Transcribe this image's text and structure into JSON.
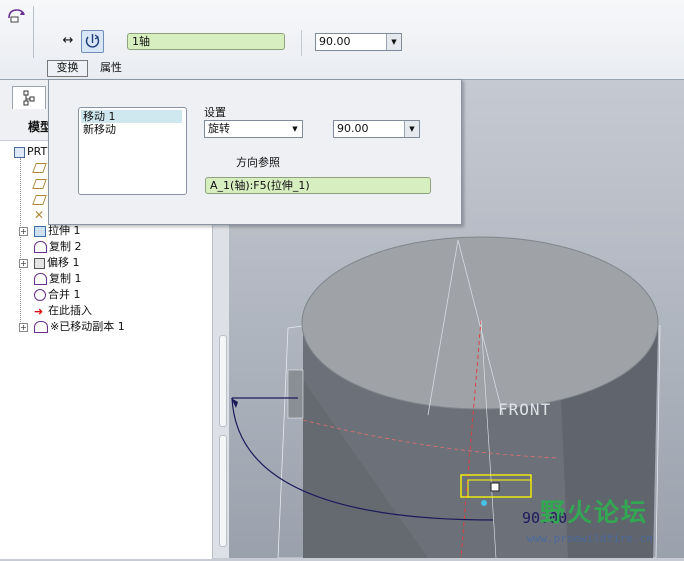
{
  "dashboard": {
    "axis_value": "1轴",
    "angle_value": "90.00",
    "tabs": [
      "变换",
      "属性"
    ]
  },
  "panel": {
    "moves": [
      "移动 1",
      "新移动"
    ],
    "settings_label": "设置",
    "settings_value": "旋转",
    "angle_value": "90.00",
    "direction_ref_label": "方向参照",
    "direction_ref_value": "A_1(轴):F5(拉伸_1)"
  },
  "navigator": {
    "title": "模型",
    "root_label": "PRT",
    "items": [
      {
        "label": "拉伸 1",
        "icon": "extrude-icon",
        "expandable": true
      },
      {
        "label": "复制 2",
        "icon": "copy-icon",
        "expandable": false
      },
      {
        "label": "偏移 1",
        "icon": "offset-icon",
        "expandable": true
      },
      {
        "label": "复制 1",
        "icon": "copy-icon",
        "expandable": false
      },
      {
        "label": "合并 1",
        "icon": "merge-icon",
        "expandable": false
      },
      {
        "label": "在此插入",
        "icon": "insert-here-arrow-icon",
        "expandable": false
      },
      {
        "label": "※已移动副本 1",
        "icon": "moved-copy-icon",
        "expandable": true
      }
    ]
  },
  "graphics": {
    "plane_label": "FRONT",
    "dimension_label": "90.00"
  },
  "watermark": {
    "title": "野火论坛",
    "url": "www.proewildfire.cn"
  },
  "colors": {
    "field_green": "#d7eec0",
    "selection": "#cfe7ef",
    "cylinder": "#6c7078",
    "highlight": "#ffff00"
  }
}
